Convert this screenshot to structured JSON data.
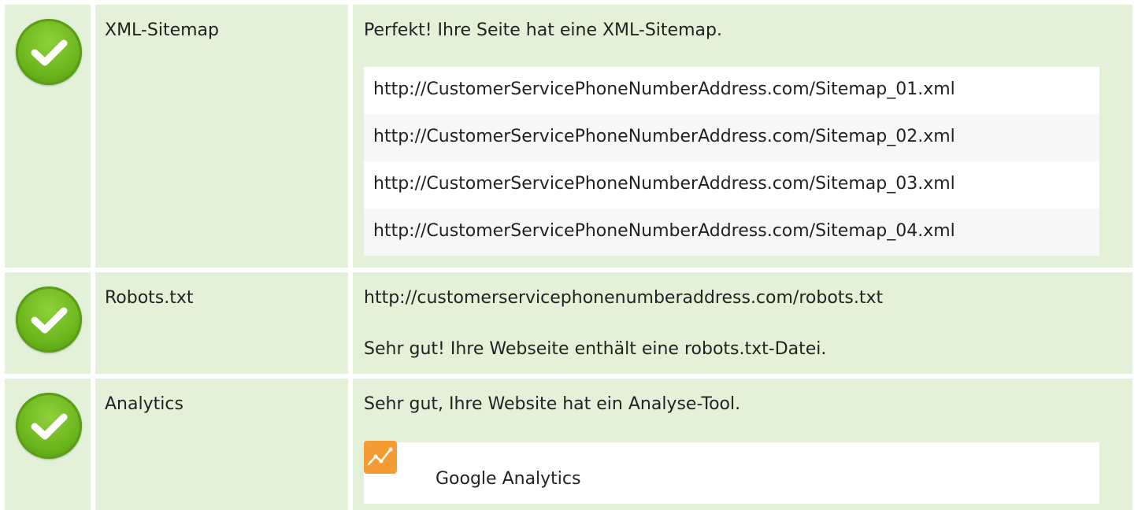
{
  "rows": [
    {
      "label": "XML-Sitemap",
      "message": "Perfekt! Ihre Seite hat eine XML-Sitemap.",
      "urls": [
        "http://CustomerServicePhoneNumberAddress.com/Sitemap_01.xml",
        "http://CustomerServicePhoneNumberAddress.com/Sitemap_02.xml",
        "http://CustomerServicePhoneNumberAddress.com/Sitemap_03.xml",
        "http://CustomerServicePhoneNumberAddress.com/Sitemap_04.xml"
      ],
      "status_icon": "check-circle-icon"
    },
    {
      "label": "Robots.txt",
      "url": "http://customerservicephonenumberaddress.com/robots.txt",
      "message": "Sehr gut! Ihre Webseite enthält eine robots.txt-Datei.",
      "status_icon": "check-circle-icon"
    },
    {
      "label": "Analytics",
      "message": "Sehr gut, Ihre Website hat ein Analyse-Tool.",
      "tool": "Google Analytics",
      "tool_icon": "google-analytics-icon",
      "status_icon": "check-circle-icon"
    }
  ],
  "colors": {
    "row_background": "#e3f1d8",
    "check_green": "#6bb51c",
    "analytics_orange": "#f59b34"
  }
}
